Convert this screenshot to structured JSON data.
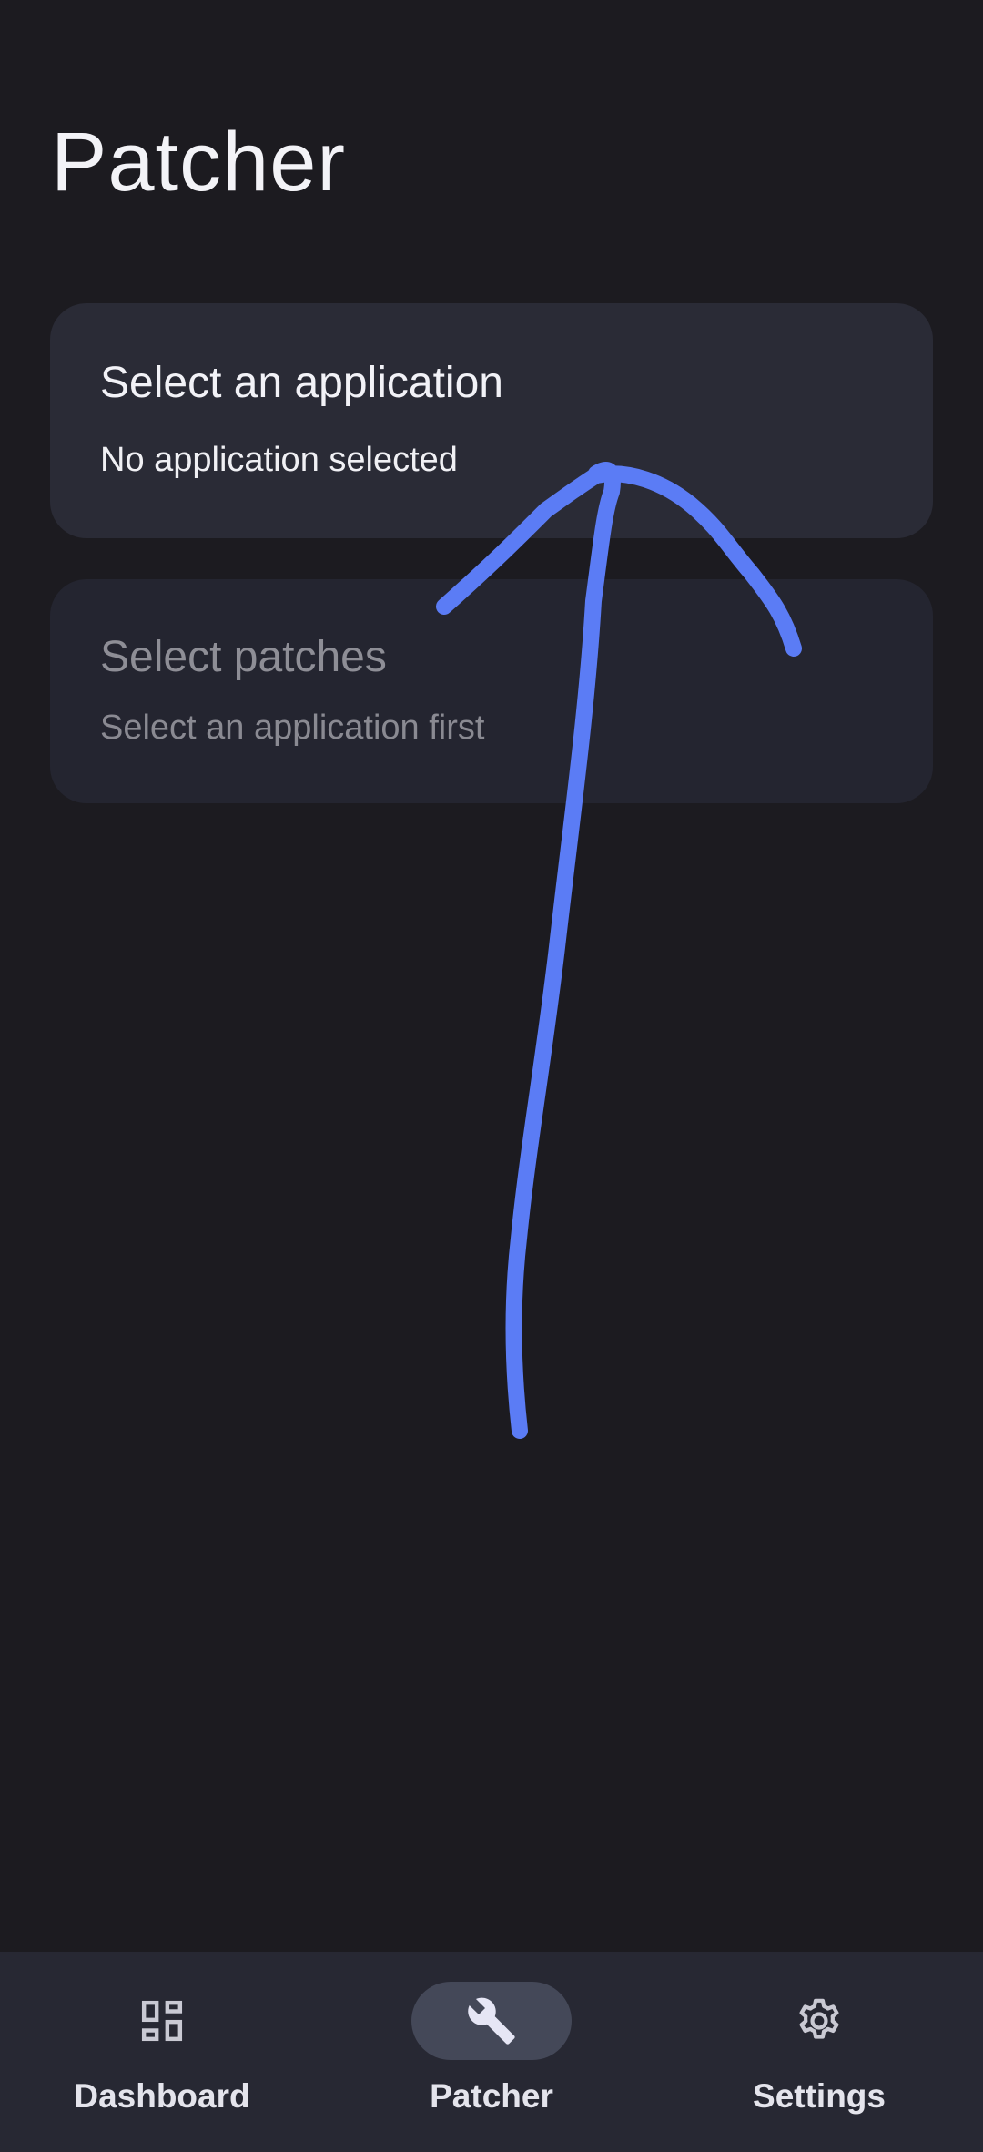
{
  "header": {
    "title": "Patcher"
  },
  "cards": {
    "application": {
      "title": "Select an application",
      "subtitle": "No application selected",
      "enabled": true
    },
    "patches": {
      "title": "Select patches",
      "subtitle": "Select an application first",
      "enabled": false
    }
  },
  "annotation": {
    "type": "hand-drawn arrow pointing up toward the application card",
    "color": "#5b7cf5"
  },
  "bottom_nav": {
    "items": [
      {
        "label": "Dashboard",
        "icon": "dashboard-icon",
        "active": false
      },
      {
        "label": "Patcher",
        "icon": "wrench-icon",
        "active": true
      },
      {
        "label": "Settings",
        "icon": "gear-icon",
        "active": false
      }
    ]
  },
  "colors": {
    "background": "#1c1b20",
    "card_active": "#2a2b36",
    "card_disabled": "#242530",
    "nav_background": "#272833",
    "nav_active_pill": "#444858",
    "arrow": "#5b7cf5"
  }
}
